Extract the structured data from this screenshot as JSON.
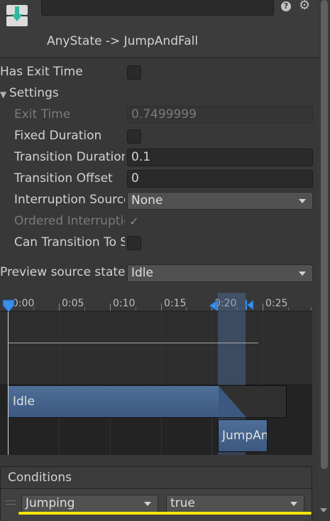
{
  "header": {
    "title": "AnyState -> JumpAndFall",
    "name_value": "",
    "help_icon": "help-icon",
    "gear_icon": "gear-icon",
    "transition_icon": "transition-icon"
  },
  "has_exit_time": {
    "label": "Has Exit Time",
    "checked": false
  },
  "settings": {
    "label": "Settings",
    "expanded": true,
    "exit_time": {
      "label": "Exit Time",
      "value": "0.7499999"
    },
    "fixed_duration": {
      "label": "Fixed Duration",
      "checked": false
    },
    "transition_duration": {
      "label": "Transition Duration",
      "value": "0.1"
    },
    "transition_offset": {
      "label": "Transition Offset",
      "value": "0"
    },
    "interruption_source": {
      "label": "Interruption Source",
      "value": "None"
    },
    "ordered_interruption": {
      "label": "Ordered Interruption",
      "checked": true
    },
    "can_transition_to_self": {
      "label": "Can Transition To Self",
      "checked": false
    }
  },
  "preview_source_state": {
    "label": "Preview source state",
    "value": "Idle"
  },
  "timeline": {
    "ticks": [
      "0:00",
      "0:05",
      "0:10",
      "0:15",
      "0:20",
      "0:25"
    ],
    "source_clip": "Idle",
    "destination_clip": "JumpAndFall"
  },
  "conditions": {
    "label": "Conditions",
    "items": [
      {
        "parameter": "Jumping",
        "value": "true"
      }
    ]
  },
  "colors": {
    "background": "#383838",
    "clip_blue": "#4a6a94",
    "highlight_yellow": "#f5e400",
    "timeline_marker_blue": "#3d8fe6"
  }
}
